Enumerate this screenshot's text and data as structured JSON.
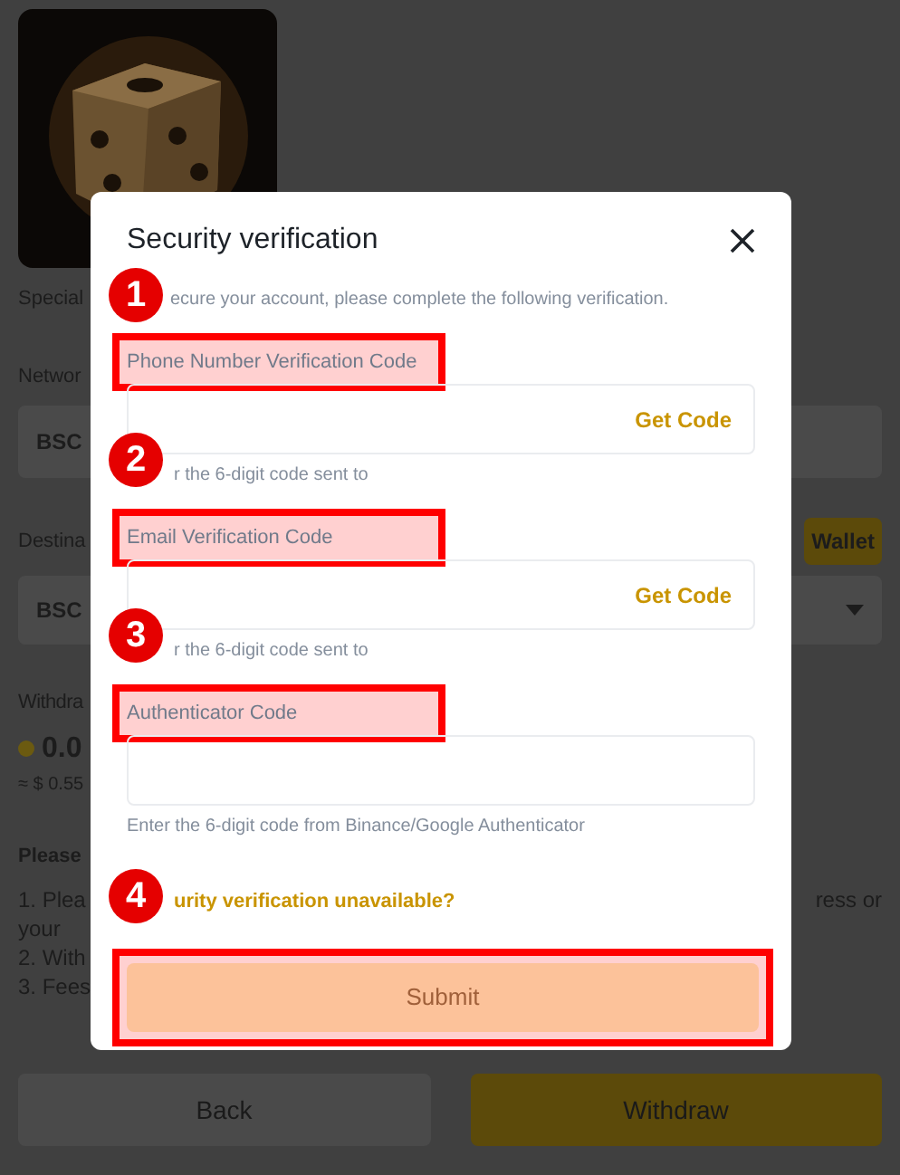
{
  "page": {
    "card_title": "Special",
    "network_label": "Networ",
    "network_value": "BSC",
    "destination_label": "Destina",
    "wallet_button": "Wallet",
    "destination_value": "BSC",
    "withdraw_label": "Withdra",
    "amount": "0.0",
    "amount_usd": "≈ $ 0.55",
    "notice_title": "Please",
    "notice_lines": [
      "1. Plea",
      "your",
      "2. With",
      "3. Fees"
    ],
    "notice_right": "ress or",
    "buttons": [
      {
        "label": "Back",
        "kind": "secondary"
      },
      {
        "label": "Withdraw",
        "kind": "primary"
      }
    ]
  },
  "dialog": {
    "title": "Security verification",
    "subtitle_marker": "1",
    "subtitle": "ecure your account, please complete the following verification.",
    "fields": [
      {
        "label": "Phone Number Verification Code",
        "highlighted": true,
        "action": "Get Code",
        "hint_marker": "2",
        "hint": "r the 6-digit code sent to"
      },
      {
        "label": "Email Verification Code",
        "highlighted": true,
        "action": "Get Code",
        "hint_marker": "3",
        "hint": "r the 6-digit code sent to"
      },
      {
        "label": "Authenticator Code",
        "highlighted": true,
        "hint": "Enter the 6-digit code from Binance/Google Authenticator"
      }
    ],
    "link_marker": "4",
    "link": "urity verification unavailable?",
    "submit": {
      "label": "Submit",
      "disabled": true,
      "highlighted": true
    }
  }
}
